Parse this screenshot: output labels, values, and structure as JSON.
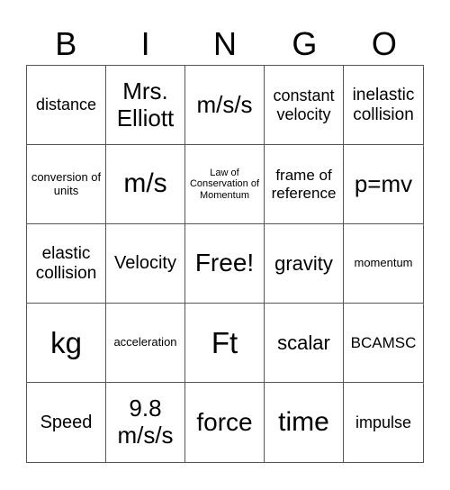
{
  "header": {
    "letters": [
      "B",
      "I",
      "N",
      "G",
      "O"
    ]
  },
  "cells": [
    "distance",
    "Mrs. Elliott",
    "m/s/s",
    "constant velocity",
    "inelastic collision",
    "conversion of units",
    "m/s",
    "Law of Conservation of Momentum",
    "frame of reference",
    "p=mv",
    "elastic collision",
    "Velocity",
    "Free!",
    "gravity",
    "momentum",
    "kg",
    "acceleration",
    "Ft",
    "scalar",
    "BCAMSC",
    "Speed",
    "9.8 m/s/s",
    "force",
    "time",
    "impulse"
  ]
}
